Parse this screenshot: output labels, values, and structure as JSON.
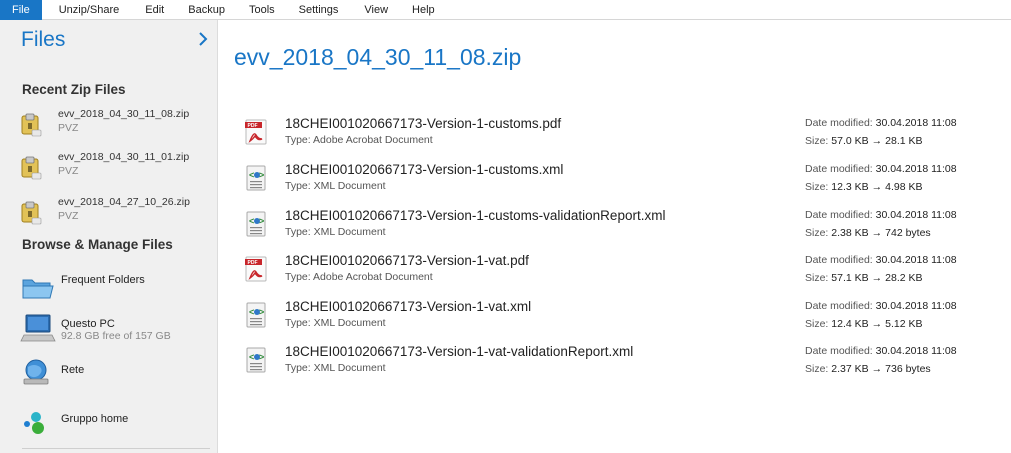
{
  "menu": {
    "items": [
      "File",
      "Unzip/Share",
      "Edit",
      "Backup",
      "Tools",
      "Settings",
      "View",
      "Help"
    ],
    "active_index": 0,
    "accent": "#1976c6"
  },
  "sidebar": {
    "title": "Files",
    "chevron_icon": "chevron-right-icon",
    "recent_heading": "Recent Zip Files",
    "recent": [
      {
        "name": "evv_2018_04_30_11_08.zip",
        "type": "PVZ",
        "icon": "zip-archive-icon"
      },
      {
        "name": "evv_2018_04_30_11_01.zip",
        "type": "PVZ",
        "icon": "zip-archive-icon"
      },
      {
        "name": "evv_2018_04_27_10_26.zip",
        "type": "PVZ",
        "icon": "zip-archive-icon"
      }
    ],
    "browse_heading": "Browse & Manage Files",
    "browse": [
      {
        "label": "Frequent Folders",
        "sub": "",
        "icon": "folder-icon"
      },
      {
        "label": "Questo PC",
        "sub": "92.8 GB free of 157 GB",
        "icon": "computer-icon"
      },
      {
        "label": "Rete",
        "sub": "",
        "icon": "network-icon"
      },
      {
        "label": "Gruppo home",
        "sub": "",
        "icon": "homegroup-icon"
      }
    ]
  },
  "main": {
    "title": "evv_2018_04_30_11_08.zip",
    "type_label": "Type:",
    "date_label": "Date modified:",
    "size_label": "Size:",
    "arrow": "→",
    "files": [
      {
        "name": "18CHEI001020667173-Version-1-customs.pdf",
        "type": "Adobe Acrobat Document",
        "date": "30.04.2018 11:08",
        "size_from": "57.0 KB",
        "size_to": "28.1 KB",
        "icon": "pdf-icon"
      },
      {
        "name": "18CHEI001020667173-Version-1-customs.xml",
        "type": "XML Document",
        "date": "30.04.2018 11:08",
        "size_from": "12.3 KB",
        "size_to": "4.98 KB",
        "icon": "xml-icon"
      },
      {
        "name": "18CHEI001020667173-Version-1-customs-validationReport.xml",
        "type": "XML Document",
        "date": "30.04.2018 11:08",
        "size_from": "2.38 KB",
        "size_to": "742 bytes",
        "icon": "xml-icon"
      },
      {
        "name": "18CHEI001020667173-Version-1-vat.pdf",
        "type": "Adobe Acrobat Document",
        "date": "30.04.2018 11:08",
        "size_from": "57.1 KB",
        "size_to": "28.2 KB",
        "icon": "pdf-icon"
      },
      {
        "name": "18CHEI001020667173-Version-1-vat.xml",
        "type": "XML Document",
        "date": "30.04.2018 11:08",
        "size_from": "12.4 KB",
        "size_to": "5.12 KB",
        "icon": "xml-icon"
      },
      {
        "name": "18CHEI001020667173-Version-1-vat-validationReport.xml",
        "type": "XML Document",
        "date": "30.04.2018 11:08",
        "size_from": "2.37 KB",
        "size_to": "736 bytes",
        "icon": "xml-icon"
      }
    ]
  }
}
